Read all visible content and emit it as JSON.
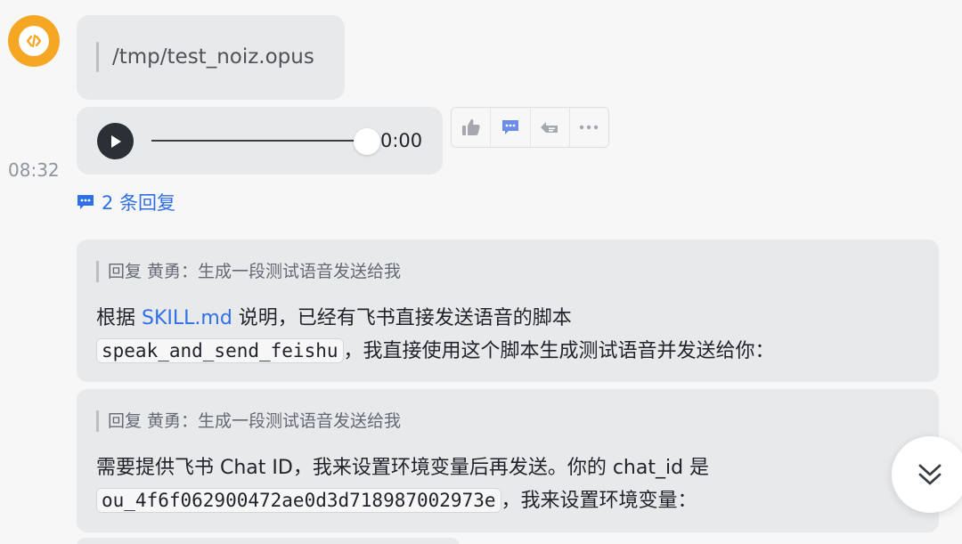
{
  "message": {
    "time": "08:32",
    "file_path": "/tmp/test_noiz.opus",
    "audio": {
      "duration": "0:00",
      "progress": 1.0
    },
    "replies_label": "2 条回复"
  },
  "actions": [
    "thumbs-up-icon",
    "comment-icon",
    "forward-icon",
    "more-icon"
  ],
  "thread": [
    {
      "quote": "回复 黄勇：生成一段测试语音发送给我",
      "line1_pre": "根据 ",
      "line1_link": "SKILL.md",
      "line1_post": " 说明，已经有飞书直接发送语音的脚本",
      "line2_code": "speak_and_send_feishu",
      "line2_post": "，我直接使用这个脚本生成测试语音并发送给你："
    },
    {
      "quote": "回复 黄勇：生成一段测试语音发送给我",
      "line1_pre": "需要提供飞书 Chat ID，我来设置环境变量后再发送。你的 chat_id 是",
      "line2_code": "ou_4f6f062900472ae0d3d718987002973e",
      "line2_post": "，我来设置环境变量："
    }
  ],
  "colors": {
    "accent": "#2f6fe8",
    "avatar": "#f5a623",
    "bubble": "#e8e9eb",
    "background": "#f7f7f8"
  }
}
